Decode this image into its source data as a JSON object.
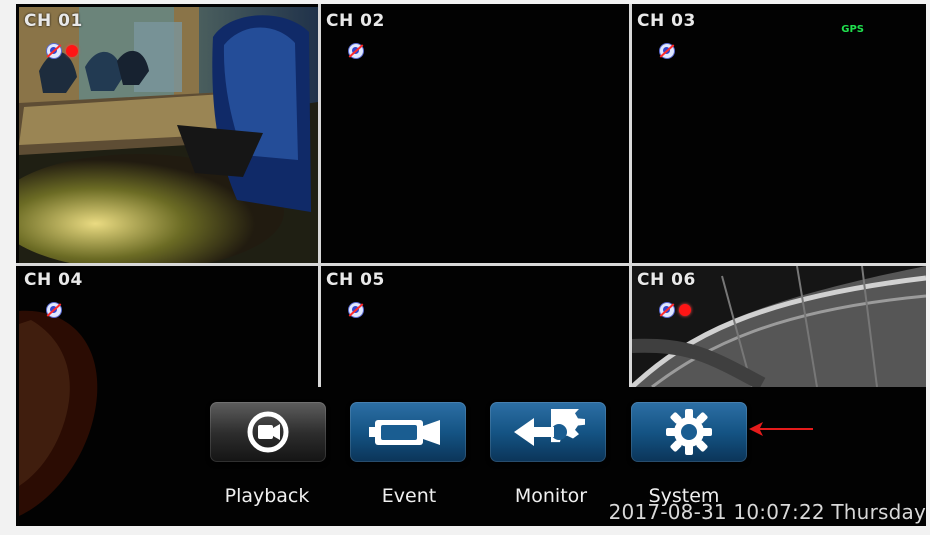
{
  "channels": [
    {
      "label": "CH 01",
      "audio_icon": "no-audio-icon",
      "recording": true
    },
    {
      "label": "CH 02",
      "audio_icon": "no-audio-icon",
      "recording": false
    },
    {
      "label": "CH 03",
      "audio_icon": "no-audio-icon",
      "recording": false,
      "gps": "GPS"
    },
    {
      "label": "CH 04",
      "audio_icon": "no-audio-icon",
      "recording": false
    },
    {
      "label": "CH 05",
      "audio_icon": "no-audio-icon",
      "recording": false
    },
    {
      "label": "CH 06",
      "audio_icon": "no-audio-icon",
      "recording": true
    }
  ],
  "menu": [
    {
      "label": "Playback",
      "icon": "camera-circle-icon"
    },
    {
      "label": "Event",
      "icon": "camera-icon"
    },
    {
      "label": "Monitor",
      "icon": "monitor-gear-arrow-icon"
    },
    {
      "label": "System",
      "icon": "gear-icon"
    }
  ],
  "status": {
    "datetime": "2017-08-31 10:07:22 Thursday"
  },
  "colors": {
    "accent": "#1b5f97",
    "gps": "#20e04e",
    "record": "#ff1515",
    "pointer": "#e51b1b"
  }
}
